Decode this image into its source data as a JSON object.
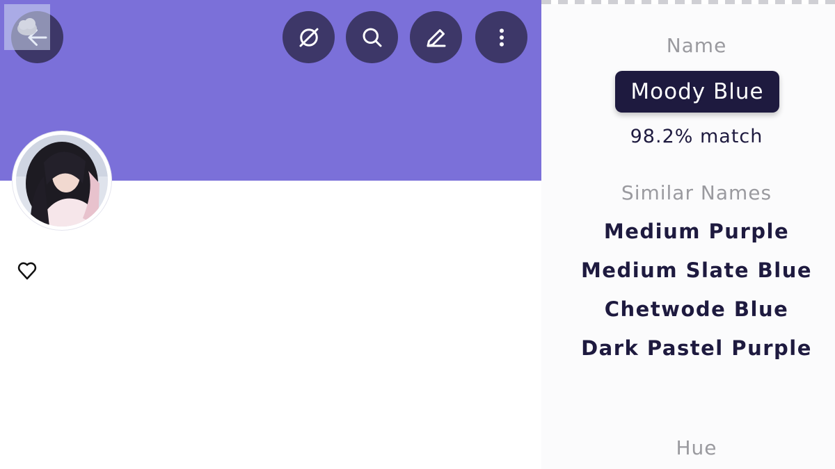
{
  "colors": {
    "banner": "#7b70d9",
    "button_background": "#3d3768",
    "icon": "#ffffff",
    "chip_background": "#1e1a3f",
    "text_dark": "#1e1a3f",
    "text_muted": "#9a9a9f"
  },
  "toolbar": {
    "back_icon": "arrow-left-icon",
    "actions": [
      {
        "icon": "hide-icon"
      },
      {
        "icon": "search-icon"
      },
      {
        "icon": "edit-icon"
      },
      {
        "icon": "more-vertical-icon"
      }
    ]
  },
  "profile": {
    "avatar_icon": "avatar",
    "like_icon": "heart-outline-icon"
  },
  "color_info": {
    "name_label": "Name",
    "name": "Moody Blue",
    "match": "98.2% match",
    "similar_label": "Similar Names",
    "similar_names": [
      "Medium Purple",
      "Medium Slate Blue",
      "Chetwode Blue",
      "Dark Pastel Purple"
    ],
    "hue_label": "Hue"
  }
}
